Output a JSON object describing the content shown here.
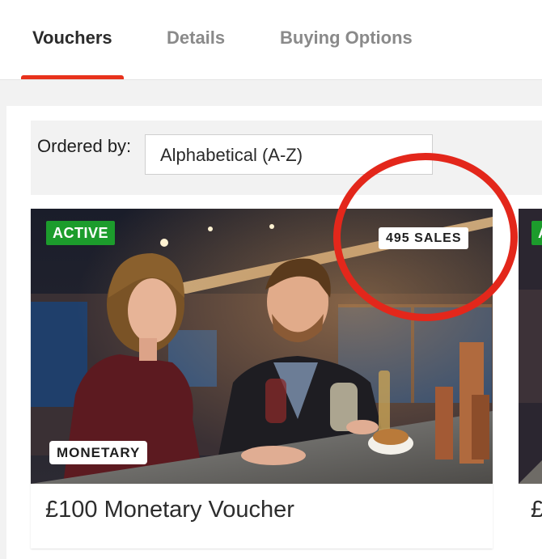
{
  "tabs": [
    {
      "label": "Vouchers",
      "active": true
    },
    {
      "label": "Details",
      "active": false
    },
    {
      "label": "Buying Options",
      "active": false
    }
  ],
  "filter": {
    "label": "Ordered by:",
    "selected": "Alphabetical (A-Z)"
  },
  "cards": [
    {
      "status": "ACTIVE",
      "sales": "495 SALES",
      "type": "MONETARY",
      "title": "£100 Monetary Voucher"
    },
    {
      "status": "A",
      "title": "£"
    }
  ],
  "colors": {
    "accent": "#e8321c",
    "active_badge": "#1c9c2c",
    "annotation": "#e3271b"
  },
  "icons": [
    "photo-couple-at-bar"
  ]
}
